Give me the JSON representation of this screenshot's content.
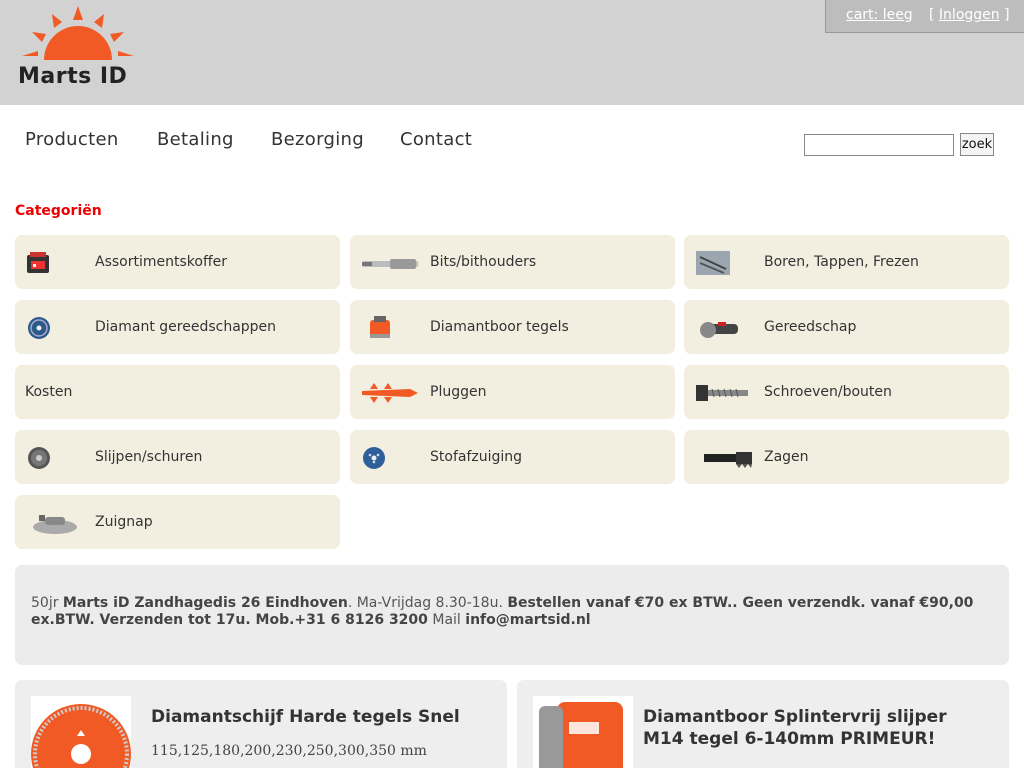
{
  "brand": {
    "logo_text": "Marts ID",
    "accent": "#f15a24"
  },
  "account": {
    "cart_label": "cart: leeg",
    "login_open": "[",
    "login_label": "Inloggen",
    "login_close": "]"
  },
  "nav": {
    "items": [
      "Producten",
      "Betaling",
      "Bezorging",
      "Contact"
    ],
    "search_value": "",
    "search_button": "zoek"
  },
  "categories": {
    "heading": "Categoriën",
    "items": [
      {
        "label": "Assortimentskoffer",
        "icon": "toolcase-icon"
      },
      {
        "label": "Bits/bithouders",
        "icon": "bit-holder-icon"
      },
      {
        "label": "Boren, Tappen, Frezen",
        "icon": "drill-bits-icon"
      },
      {
        "label": "Diamant gereedschappen",
        "icon": "diamond-disc-icon"
      },
      {
        "label": "Diamantboor tegels",
        "icon": "core-drill-icon"
      },
      {
        "label": "Gereedschap",
        "icon": "angle-grinder-icon"
      },
      {
        "label": "Kosten",
        "icon": ""
      },
      {
        "label": "Pluggen",
        "icon": "wall-plug-icon"
      },
      {
        "label": "Schroeven/bouten",
        "icon": "screw-icon"
      },
      {
        "label": "Slijpen/schuren",
        "icon": "grinding-disc-icon"
      },
      {
        "label": "Stofafzuiging",
        "icon": "dust-disc-icon"
      },
      {
        "label": "Zagen",
        "icon": "saw-blade-icon"
      },
      {
        "label": "Zuignap",
        "icon": "suction-cup-icon"
      }
    ]
  },
  "info": {
    "p1": "50jr ",
    "p2": "Marts iD Zandhagedis 26 Eindhoven",
    "p3": ". Ma-Vrijdag 8.30-18u. ",
    "p4": "Bestellen vanaf €70 ex BTW.. Geen verzendk. vanaf €90,00 ex.BTW. Verzenden tot 17u. Mob.+31 6 8126 3200",
    "p5": " Mail ",
    "p6": "info@martsid.nl"
  },
  "products": [
    {
      "title": "Diamantschijf Harde tegels Snel",
      "subtitle": "115,125,180,200,230,250,300,350 mm"
    },
    {
      "title": "Diamantboor Splintervrij slijper M14 tegel 6-140mm PRIMEUR!",
      "subtitle": ""
    }
  ]
}
